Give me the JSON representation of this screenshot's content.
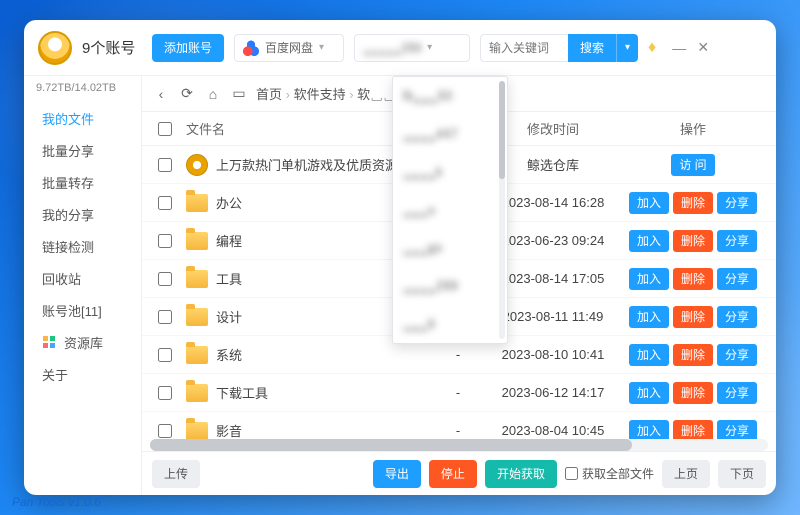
{
  "header": {
    "account_title": "9个账号",
    "add_account_label": "添加账号",
    "cloud_select_label": "百度网盘",
    "account_select_label": "␣␣␣␣␣299",
    "search_placeholder": "输入关键词",
    "search_label": "搜索"
  },
  "quota": "9.72TB/14.02TB",
  "sidebar": {
    "items": [
      {
        "label": "我的文件",
        "active": true
      },
      {
        "label": "批量分享"
      },
      {
        "label": "批量转存"
      },
      {
        "label": "我的分享"
      },
      {
        "label": "链接检测"
      },
      {
        "label": "回收站"
      },
      {
        "label": "账号池[11]"
      },
      {
        "label": "资源库",
        "icon": "grid"
      },
      {
        "label": "关于"
      }
    ]
  },
  "breadcrumb": {
    "items": [
      "首页",
      "软件支持",
      "软␣␣"
    ]
  },
  "columns": {
    "name": "文件名",
    "size": "␣␣",
    "time": "修改时间",
    "ops": "操作"
  },
  "rows": [
    {
      "icon": "disc",
      "name": "上万款热门单机游戏及优质资源␣",
      "size": "",
      "time_text": "鲸选仓库",
      "ops": [
        "访 问"
      ]
    },
    {
      "icon": "folder",
      "name": "办公",
      "size": "-",
      "time": "2023-08-14 16:28",
      "ops": [
        "加入",
        "删除",
        "分享"
      ]
    },
    {
      "icon": "folder",
      "name": "编程",
      "size": "-",
      "time": "2023-06-23 09:24",
      "ops": [
        "加入",
        "删除",
        "分享"
      ]
    },
    {
      "icon": "folder",
      "name": "工具",
      "size": "-",
      "time": "2023-08-14 17:05",
      "ops": [
        "加入",
        "删除",
        "分享"
      ]
    },
    {
      "icon": "folder",
      "name": "设计",
      "size": "-",
      "time": "2023-08-11 11:49",
      "ops": [
        "加入",
        "删除",
        "分享"
      ]
    },
    {
      "icon": "folder",
      "name": "系统",
      "size": "-",
      "time": "2023-08-10 10:41",
      "ops": [
        "加入",
        "删除",
        "分享"
      ]
    },
    {
      "icon": "folder",
      "name": "下载工具",
      "size": "-",
      "time": "2023-06-12 14:17",
      "ops": [
        "加入",
        "删除",
        "分享"
      ]
    },
    {
      "icon": "folder",
      "name": "影音",
      "size": "-",
      "time": "2023-08-04 10:45",
      "ops": [
        "加入",
        "删除",
        "分享"
      ]
    }
  ],
  "dropdown": {
    "options": [
      "lb␣␣␣50",
      "␣␣␣␣447",
      "␣␣␣␣k",
      "␣␣␣u",
      "␣␣␣go",
      "␣␣␣␣299",
      "␣␣␣6"
    ]
  },
  "footer": {
    "upload": "上传",
    "export": "导出",
    "stop": "停止",
    "start": "开始获取",
    "get_all": "获取全部文件",
    "prev": "上页",
    "next": "下页"
  },
  "version": "Pan Tools v1.0.6",
  "op_colors": {
    "访 问": "btn-blue",
    "加入": "btn-blue",
    "删除": "btn-red",
    "分享": "btn-blue"
  }
}
